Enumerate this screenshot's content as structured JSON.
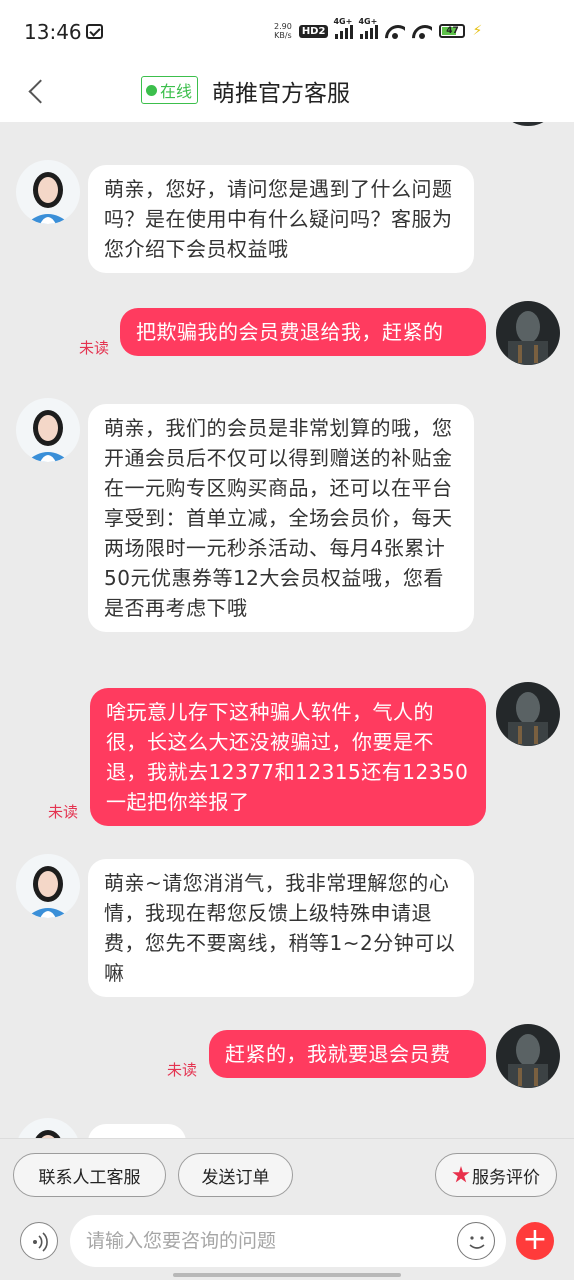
{
  "status_bar": {
    "time": "13:46",
    "net_speed_value": "2.90",
    "net_speed_unit": "KB/s",
    "hd_label": "HD2",
    "signal_1_label": "4G+",
    "signal_2_label": "4G+",
    "battery_level": "47"
  },
  "header": {
    "online_label": "在线",
    "title": "萌推官方客服"
  },
  "messages": [
    {
      "side": "left",
      "text": "萌亲，您好，请问您是遇到了什么问题吗？是在使用中有什么疑问吗？客服为您介绍下会员权益哦"
    },
    {
      "side": "right",
      "text": "把欺骗我的会员费退给我，赶紧的",
      "status": "未读"
    },
    {
      "side": "left",
      "text": "萌亲，我们的会员是非常划算的哦，您开通会员后不仅可以得到赠送的补贴金在一元购专区购买商品，还可以在平台享受到：首单立减，全场会员价，每天两场限时一元秒杀活动、每月4张累计50元优惠券等12大会员权益哦，您看是否再考虑下哦"
    },
    {
      "side": "right",
      "text": "啥玩意儿存下这种骗人软件，气人的很，长这么大还没被骗过，你要是不退，我就去12377和12315还有12350一起把你举报了",
      "status": "未读"
    },
    {
      "side": "left",
      "text": "萌亲~请您消消气，我非常理解您的心情，我现在帮您反馈上级特殊申请退费，您先不要离线，稍等1~2分钟可以嘛"
    },
    {
      "side": "right",
      "text": "赶紧的，我就要退会员费",
      "status": "未读"
    }
  ],
  "quick_actions": {
    "contact_agent": "联系人工客服",
    "send_order": "发送订单",
    "rate_service": "服务评价"
  },
  "input": {
    "placeholder": "请输入您要咨询的问题"
  },
  "colors": {
    "accent": "#ff3b5f",
    "online_green": "#3cbf4c",
    "unread_red": "#e43350",
    "background": "#ebebeb"
  },
  "icons": [
    "back-chevron-icon",
    "voice-icon",
    "emoji-icon",
    "plus-icon",
    "star-icon"
  ]
}
